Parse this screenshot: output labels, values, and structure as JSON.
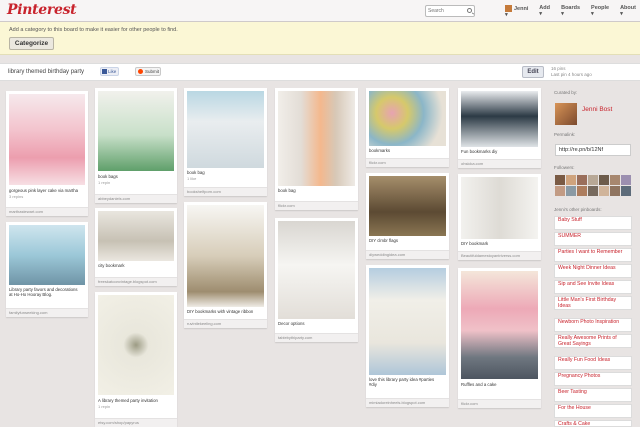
{
  "header": {
    "logo": "Pinterest",
    "search_placeholder": "Search",
    "nav": {
      "user": "Jenni",
      "add": "Add",
      "boards": "Boards",
      "people": "People",
      "about": "About"
    }
  },
  "notice": {
    "text": "Add a category to this board to make it easier for other people to find.",
    "button": "Categorize"
  },
  "board": {
    "title": "library themed birthday party",
    "like_label": "Like",
    "submit_label": "Submit",
    "edit_label": "Edit",
    "pins_count": "16 pins",
    "last_pin": "Last pin 4 hours ago"
  },
  "pins": [
    {
      "desc": "gorgeous pink layer cake via martha",
      "meta": "3 repins",
      "source": "marthastewart.com"
    },
    {
      "desc": "Library party favors and decorations",
      "desc2": "at Ho-Ho Hooray Blog.",
      "meta": "",
      "source": "familyfunseeking.com"
    },
    {
      "desc": "book bags",
      "meta": "1 repin",
      "source": "abbeydaniels.com"
    },
    {
      "desc": "city bookmark",
      "meta": "",
      "source": "freeskatoonvintage.blogspot.com"
    },
    {
      "desc": "A library themed party invitation",
      "meta": "1 repin",
      "source": "etsy.com/shop/papyrus"
    },
    {
      "desc": "book bag",
      "meta": "1 like",
      "source": "bookshelfporn.com"
    },
    {
      "desc": "DIY bookmarks with vintage ribbon",
      "meta": "",
      "source": "ruvintlekeeling.com"
    },
    {
      "desc": "book bag",
      "meta": "",
      "source": "flickr.com"
    },
    {
      "desc": "Decor options",
      "meta": "",
      "source": "tablebythiparty.com"
    },
    {
      "desc": "bookmarks",
      "meta": "",
      "source": "flickr.com"
    },
    {
      "desc": "DIY clmbr flags",
      "meta": "",
      "source": "diyweddingidea.com"
    },
    {
      "desc": "love this library party idea #parties",
      "desc2": "#diy",
      "meta": "",
      "source": "mimiadoreinheels.blogspot.com"
    },
    {
      "desc": "Fun bookmarks diy",
      "meta": "",
      "source": "ohsicka.com"
    },
    {
      "desc": "DIY bookmark",
      "meta": "",
      "source": "Beautifuldamestoyantriverss.com"
    },
    {
      "desc": "Ruffles and a cake",
      "meta": "",
      "source": "flickr.com"
    }
  ],
  "sidebar": {
    "curated_by": "Curated by:",
    "curator_name": "Jenni Bost",
    "permalink_label": "Permalink:",
    "permalink": "http://re.pn/b/12Nf",
    "followers_label": "Followers:",
    "other_boards_label": "Jenni's other pinboards:",
    "boards": [
      "Baby Stuff",
      "SUMMER",
      "Parties I want to Remember",
      "Week Night Dinner Ideas",
      "Sip and See Invite Ideas",
      "Little Man's First Birthday Ideas",
      "Newborn Photo Inspiration",
      "Really Awesome Prints of Great Sayings",
      "Really Fun Food Ideas",
      "Pregnancy Photos",
      "Beer Tasting",
      "For the House",
      "Crafts & Cake"
    ]
  },
  "colors": {
    "brand": "#c8232c",
    "page_bg": "#e8e4e3",
    "notice_bg": "#fbf7d5"
  }
}
